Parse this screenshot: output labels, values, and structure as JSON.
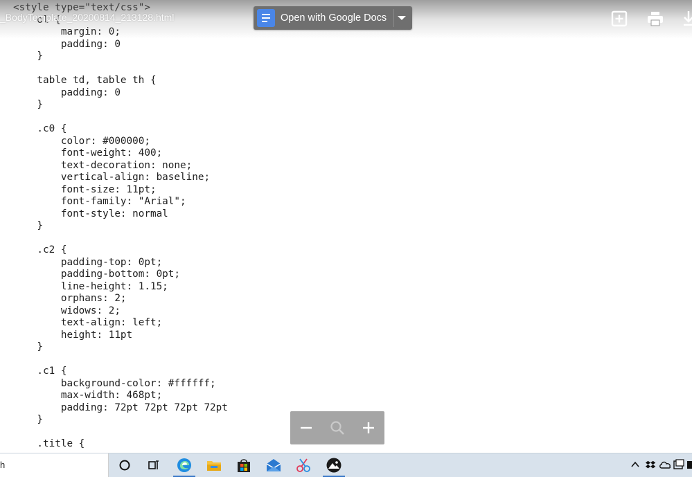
{
  "document": {
    "filename": "_BodyTemplate_20200814_213128.html",
    "code_lines": [
      "<style type=\"text/css\">",
      "    ol {",
      "        margin: 0;",
      "        padding: 0",
      "    }",
      "",
      "    table td, table th {",
      "        padding: 0",
      "    }",
      "",
      "    .c0 {",
      "        color: #000000;",
      "        font-weight: 400;",
      "        text-decoration: none;",
      "        vertical-align: baseline;",
      "        font-size: 11pt;",
      "        font-family: \"Arial\";",
      "        font-style: normal",
      "    }",
      "",
      "    .c2 {",
      "        padding-top: 0pt;",
      "        padding-bottom: 0pt;",
      "        line-height: 1.15;",
      "        orphans: 2;",
      "        widows: 2;",
      "        text-align: left;",
      "        height: 11pt",
      "    }",
      "",
      "    .c1 {",
      "        background-color: #ffffff;",
      "        max-width: 468pt;",
      "        padding: 72pt 72pt 72pt 72pt",
      "    }",
      "",
      "    .title {"
    ]
  },
  "toolbar": {
    "open_with_label": "Open with Google Docs",
    "icons": [
      "add-to-drive-icon",
      "print-icon",
      "download-icon"
    ]
  },
  "zoom": {
    "icons": [
      "zoom-out-icon",
      "magnifier-icon",
      "zoom-in-icon"
    ]
  },
  "taskbar": {
    "search_text": "h",
    "apps": [
      "cortana-icon",
      "task-view-icon",
      "edge-icon",
      "file-explorer-icon",
      "store-icon",
      "mail-icon",
      "snip-sketch-icon",
      "photos-icon"
    ],
    "tray": [
      "chevron-up-icon",
      "dropbox-icon",
      "onedrive-icon",
      "tray-app-icon",
      "battery-icon"
    ]
  },
  "colors": {
    "docs_blue": "#4a86e8",
    "button_gray": "#6f6f6f",
    "taskbar_bg": "#d8e2ec",
    "edge_blue": "#1f8de0"
  }
}
